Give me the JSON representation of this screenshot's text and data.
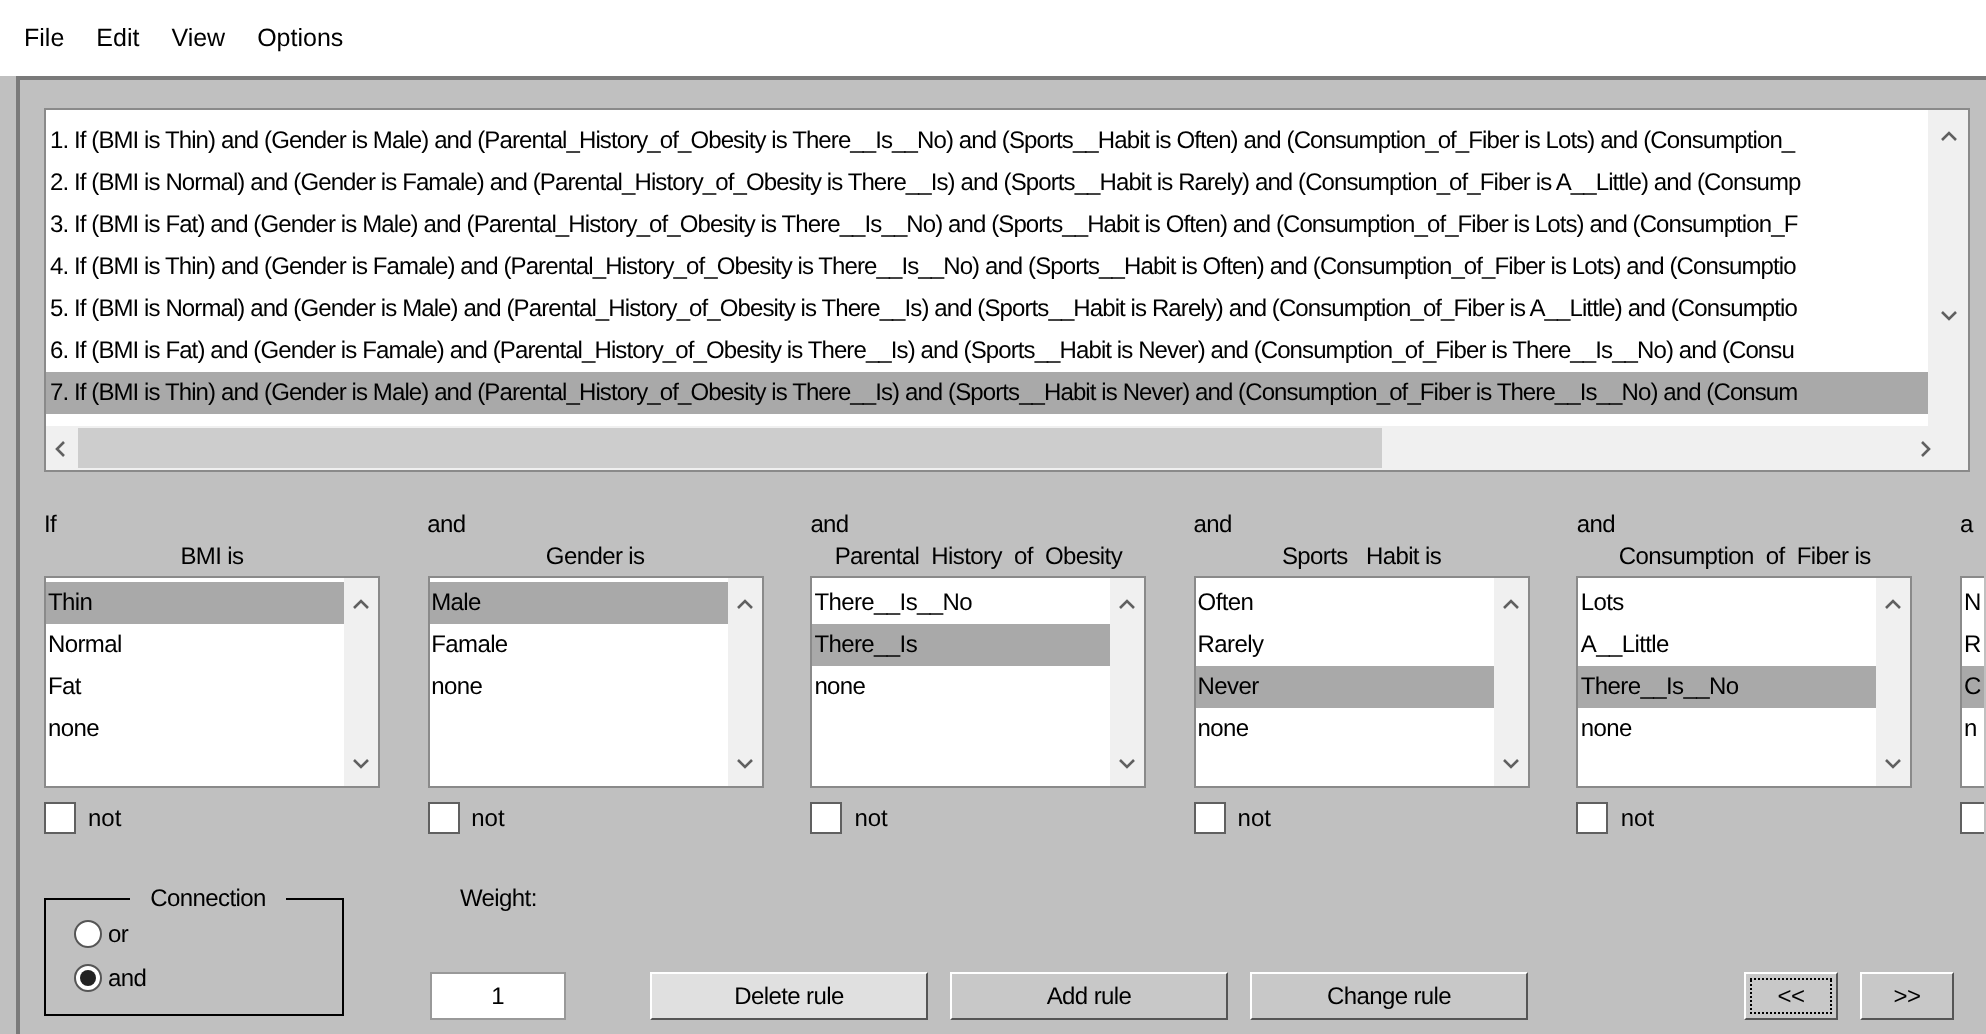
{
  "menu": [
    "File",
    "Edit",
    "View",
    "Options"
  ],
  "rules": [
    {
      "text": "1. If (BMI is Thin) and (Gender is Male) and (Parental_History_of_Obesity is There__Is__No) and (Sports__Habit is Often) and (Consumption_of_Fiber is Lots) and (Consumption_",
      "selected": false
    },
    {
      "text": "2. If (BMI is Normal) and (Gender is Famale) and (Parental_History_of_Obesity is There__Is) and (Sports__Habit is Rarely) and (Consumption_of_Fiber is A__Little) and (Consump",
      "selected": false
    },
    {
      "text": "3. If (BMI is Fat) and (Gender is Male) and (Parental_History_of_Obesity is There__Is__No) and (Sports__Habit is Often) and (Consumption_of_Fiber is Lots) and (Consumption_F",
      "selected": false
    },
    {
      "text": "4. If (BMI is Thin) and (Gender is Famale) and (Parental_History_of_Obesity is There__Is__No) and (Sports__Habit is Often) and (Consumption_of_Fiber is Lots) and (Consumptio",
      "selected": false
    },
    {
      "text": "5. If (BMI is Normal) and (Gender is Male) and (Parental_History_of_Obesity is There__Is) and (Sports__Habit is Rarely) and (Consumption_of_Fiber is A__Little) and (Consumptio",
      "selected": false
    },
    {
      "text": "6. If (BMI is Fat) and (Gender is Famale) and (Parental_History_of_Obesity is There__Is) and (Sports__Habit is Never) and (Consumption_of_Fiber is There__Is__No) and (Consu",
      "selected": false
    },
    {
      "text": "7. If (BMI is Thin) and (Gender is Male) and (Parental_History_of_Obesity is There__Is) and (Sports__Habit is Never) and (Consumption_of_Fiber is There__Is__No) and (Consum",
      "selected": true
    }
  ],
  "conditions": [
    {
      "connector": "If",
      "title": "BMI is",
      "options": [
        {
          "label": "Thin",
          "selected": true
        },
        {
          "label": "Normal",
          "selected": false
        },
        {
          "label": "Fat",
          "selected": false
        },
        {
          "label": "none",
          "selected": false
        }
      ],
      "negate": {
        "label": "not",
        "checked": false
      }
    },
    {
      "connector": "and",
      "title": "Gender is",
      "options": [
        {
          "label": "Male",
          "selected": true
        },
        {
          "label": "Famale",
          "selected": false
        },
        {
          "label": "none",
          "selected": false
        }
      ],
      "negate": {
        "label": "not",
        "checked": false
      }
    },
    {
      "connector": "and",
      "title": "Parental  History  of  Obesity",
      "options": [
        {
          "label": "There__Is__No",
          "selected": false
        },
        {
          "label": "There__Is",
          "selected": true
        },
        {
          "label": "none",
          "selected": false
        }
      ],
      "negate": {
        "label": "not",
        "checked": false
      }
    },
    {
      "connector": "and",
      "title": "Sports   Habit is",
      "options": [
        {
          "label": "Often",
          "selected": false
        },
        {
          "label": "Rarely",
          "selected": false
        },
        {
          "label": "Never",
          "selected": true
        },
        {
          "label": "none",
          "selected": false
        }
      ],
      "negate": {
        "label": "not",
        "checked": false
      }
    },
    {
      "connector": "and",
      "title": "Consumption  of  Fiber is",
      "options": [
        {
          "label": "Lots",
          "selected": false
        },
        {
          "label": "A__Little",
          "selected": false
        },
        {
          "label": "There__Is__No",
          "selected": true
        },
        {
          "label": "none",
          "selected": false
        }
      ],
      "negate": {
        "label": "not",
        "checked": false
      }
    },
    {
      "connector": "a",
      "options": [
        {
          "label": "N",
          "selected": false
        },
        {
          "label": "R",
          "selected": false
        },
        {
          "label": "C",
          "selected": true
        },
        {
          "label": "n",
          "selected": false
        }
      ],
      "negate": {
        "checked": false
      }
    }
  ],
  "connection": {
    "title": "Connection",
    "options": [
      {
        "label": "or",
        "selected": false
      },
      {
        "label": "and",
        "selected": true
      }
    ]
  },
  "weight": {
    "label": "Weight:",
    "value": "1"
  },
  "buttons": [
    {
      "label": "Delete rule",
      "hovered": true,
      "focused": false
    },
    {
      "label": "Add rule",
      "hovered": false,
      "focused": false
    },
    {
      "label": "Change rule",
      "hovered": false,
      "focused": false
    }
  ],
  "nav_buttons": [
    {
      "label": "<<",
      "hovered": false,
      "focused": true
    },
    {
      "label": ">>",
      "hovered": false,
      "focused": false
    }
  ]
}
